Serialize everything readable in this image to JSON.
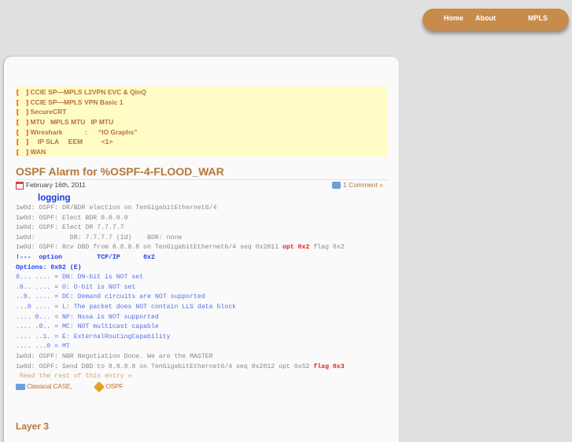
{
  "nav": {
    "items": [
      "Home",
      "About",
      "MPLS"
    ]
  },
  "notice": {
    "bracket": "[    ]",
    "items": [
      "CCIE SP—MPLS L2VPN EVC & QinQ",
      "CCIE SP—MPLS VPN Basic 1",
      "SecureCRT",
      "MTU   MPLS MTU   IP MTU",
      "Wireshark            :      “IO Graphs”",
      "    IP SLA     EEM          <1>",
      "WAN"
    ]
  },
  "post": {
    "title": "OSPF Alarm for %OSPF-4-FLOOD_WAR",
    "date": "February 16th, 2011",
    "comments": "1 Comment »",
    "heading": "logging",
    "lines": [
      {
        "t": "1w0d: OSPF: DR/BDR election on TenGigabitEthernet6/4"
      },
      {
        "t": "1w0d: OSPF: Elect BDR 0.0.0.0"
      },
      {
        "t": "1w0d: OSPF: Elect DR 7.7.7.7"
      },
      {
        "t": "1w0d:         DR: 7.7.7.7 (Id)    BDR: none"
      },
      {
        "t": "1w0d: OSPF: Rcv DBD from 8.8.8.8 on TenGigabitEthernet6/4 seq 0x2011 ",
        "r": "opt 0x2",
        "t2": " flag 0x2"
      },
      {
        "b": "!---  option         TCP/IP      0x2"
      },
      {
        "b": "Options: 0x02 (E)"
      },
      {
        "l": "0... .... = DN: DN-bit is NOT set"
      },
      {
        "l": ".0.. .... = O: O-bit is NOT set"
      },
      {
        "l": "..0. .... = DC: Demand circuits are NOT supported"
      },
      {
        "l": "...0 .... = L: The packet does NOT contain LLS data block"
      },
      {
        "l": ".... 0... = NP: Nssa is NOT supported"
      },
      {
        "l": ".... .0.. = MC: NOT multicast capable"
      },
      {
        "l": ".... ..1. = E: ExternalRoutingCapability"
      },
      {
        "l": ".... ...0 = MT"
      },
      {
        "t": "1w0d: OSPF: NBR Negotiation Done. We are the MASTER"
      },
      {
        "t": "1w0d: OSPF: Send DBD to 8.8.8.8 on TenGigabitEthernet6/4 seq 0x2012 opt 0x52 ",
        "r": "flag 0x3"
      }
    ],
    "read_more": " Read the rest of this entry »",
    "category": "Classical CASE,",
    "tag": "OSPF"
  },
  "next_post": {
    "title": "Layer 3"
  }
}
